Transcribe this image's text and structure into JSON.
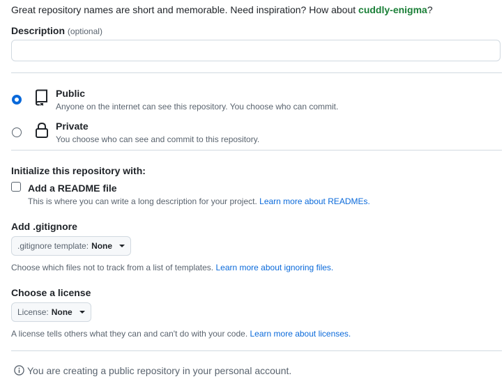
{
  "name_hint": {
    "prefix": "Great repository names are short and memorable. Need inspiration? How about ",
    "suggestion": "cuddly-enigma",
    "suffix": "?"
  },
  "description": {
    "label": "Description",
    "optional": "(optional)",
    "value": ""
  },
  "visibility": {
    "options": [
      {
        "title": "Public",
        "desc": "Anyone on the internet can see this repository. You choose who can commit.",
        "selected": true,
        "icon": "repo-icon"
      },
      {
        "title": "Private",
        "desc": "You choose who can see and commit to this repository.",
        "selected": false,
        "icon": "lock-icon"
      }
    ]
  },
  "init": {
    "heading": "Initialize this repository with:",
    "readme_label": "Add a README file",
    "readme_checked": false,
    "readme_desc": "This is where you can write a long description for your project. ",
    "readme_link": "Learn more about READMEs."
  },
  "gitignore": {
    "heading": "Add .gitignore",
    "select_key": ".gitignore template:",
    "select_value": "None",
    "help": "Choose which files not to track from a list of templates. ",
    "help_link": "Learn more about ignoring files."
  },
  "license": {
    "heading": "Choose a license",
    "select_key": "License:",
    "select_value": "None",
    "help": "A license tells others what they can and can't do with your code. ",
    "help_link": "Learn more about licenses."
  },
  "footer": {
    "note": "You are creating a public repository in your personal account."
  },
  "colors": {
    "accent": "#0969da",
    "success": "#1a7f37",
    "border": "#d1d9e0",
    "muted": "#59636e"
  }
}
